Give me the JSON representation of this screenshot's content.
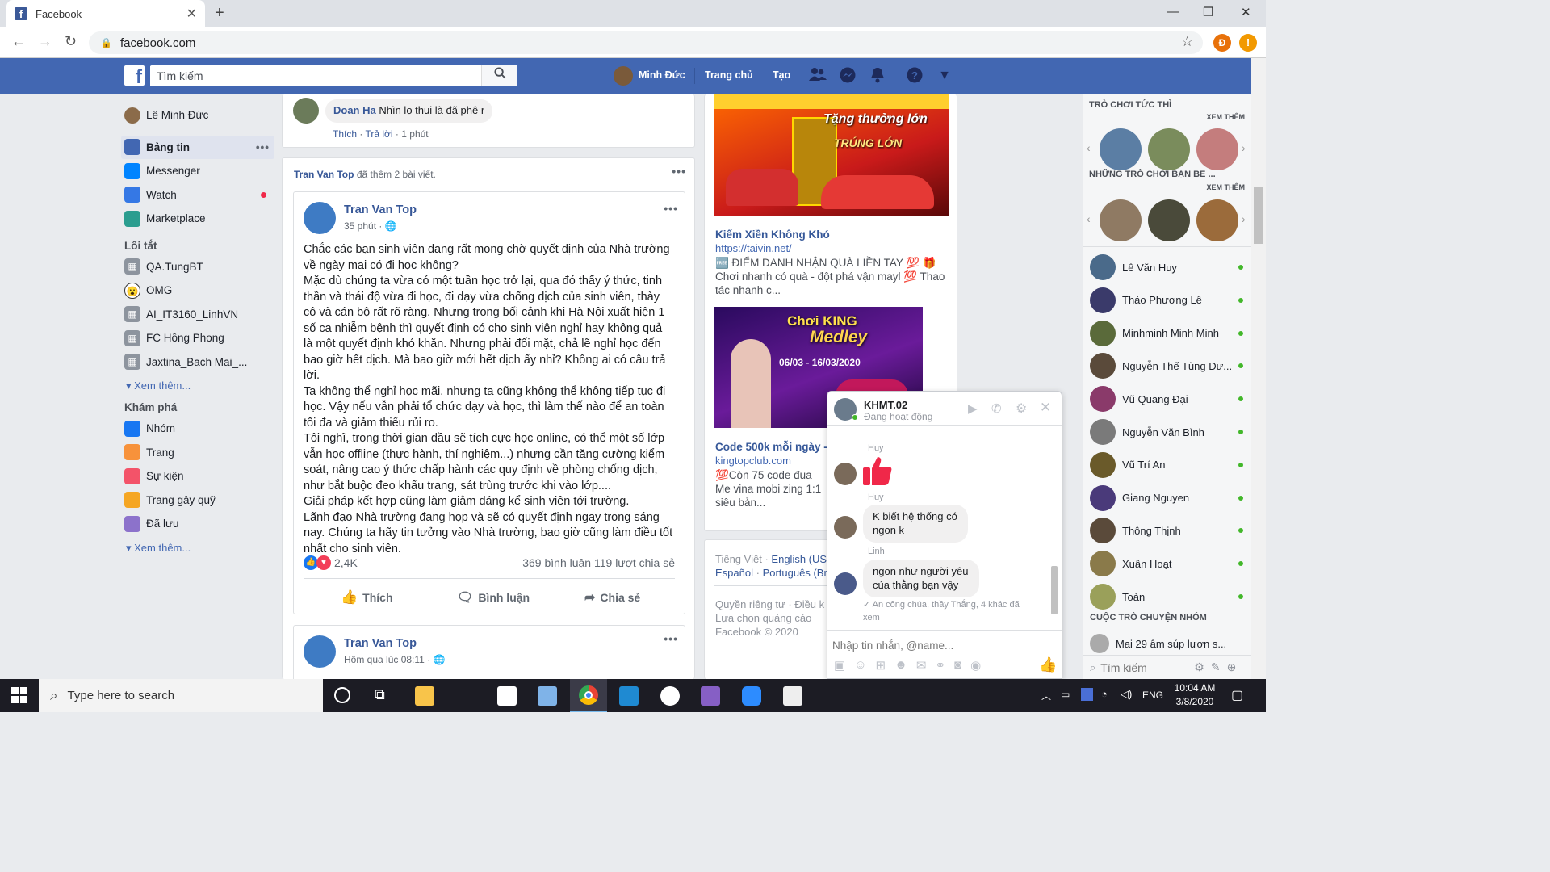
{
  "browser": {
    "tab_title": "Facebook",
    "url": "facebook.com",
    "profile_initial": "Đ",
    "alert_badge": "!"
  },
  "header": {
    "search_placeholder": "Tìm kiếm",
    "user_name": "Minh Đức",
    "home": "Trang chủ",
    "create": "Tạo"
  },
  "sidebar": {
    "profile_name": "Lê Minh Đức",
    "main": [
      {
        "label": "Bảng tin",
        "icon": "news-feed-icon",
        "color": "#4267b2"
      },
      {
        "label": "Messenger",
        "icon": "messenger-icon",
        "color": "#0084ff"
      },
      {
        "label": "Watch",
        "icon": "watch-icon",
        "color": "#3578e5"
      },
      {
        "label": "Marketplace",
        "icon": "marketplace-icon",
        "color": "#2b9d8f"
      }
    ],
    "shortcuts_title": "Lối tắt",
    "shortcuts": [
      {
        "label": "QA.TungBT",
        "icon": "group-icon"
      },
      {
        "label": "OMG",
        "icon": "omg-face-icon"
      },
      {
        "label": "AI_IT3160_LinhVN",
        "icon": "group-icon"
      },
      {
        "label": "FC Hồng Phong",
        "icon": "group-icon"
      },
      {
        "label": "Jaxtina_Bach Mai_...",
        "icon": "group-icon"
      }
    ],
    "see_more": "Xem thêm...",
    "explore_title": "Khám phá",
    "explore": [
      {
        "label": "Nhóm",
        "icon": "groups-icon",
        "color": "#1877f2"
      },
      {
        "label": "Trang",
        "icon": "flag-icon",
        "color": "#f7923b"
      },
      {
        "label": "Sự kiện",
        "icon": "calendar-icon",
        "color": "#f35369"
      },
      {
        "label": "Trang gây quỹ",
        "icon": "fundraiser-icon",
        "color": "#f5a623"
      },
      {
        "label": "Đã lưu",
        "icon": "saved-icon",
        "color": "#8c72cb"
      }
    ],
    "see_more2": "Xem thêm..."
  },
  "feed": {
    "comment": {
      "author": "Doan Ha",
      "text": "Nhìn lọ thui là đã phê r",
      "like": "Thích",
      "reply": "Trả lời",
      "time": "1 phút"
    },
    "group_header": {
      "author": "Tran Van Top",
      "action": "đã thêm 2 bài viết."
    },
    "post1": {
      "author": "Tran Van Top",
      "time": "35 phút",
      "text": "Chắc các bạn sinh viên đang rất mong chờ quyết định của Nhà trường về ngày mai có đi học không?\nMặc dù chúng ta vừa có một tuần học trở lại, qua đó thấy ý thức, tinh thần và thái độ vừa đi học, đi dạy vừa chống dịch của sinh viên, thày cô và cán bộ rất rõ ràng. Nhưng trong bối cảnh khi Hà Nội xuất hiện 1 số ca nhiễm bệnh thì quyết định có cho sinh viên nghỉ hay không quả là một quyết định khó khăn. Nhưng phải đối mặt, chả lẽ nghỉ học đến bao giờ hết dịch. Mà bao giờ mới hết dịch ấy nhỉ? Không ai có câu trả lời.\nTa không thể nghỉ học mãi, nhưng ta cũng không thể không tiếp tục đi học. Vậy nếu vẫn phải tổ chức dạy và học, thì làm thế nào để an toàn tối đa và giảm thiểu rủi ro.\nTôi nghĩ, trong thời gian đầu sẽ tích cực học online, có thể một số lớp vẫn học offline (thực hành, thí nghiệm...) nhưng cần tăng cường kiểm soát, nâng cao ý thức chấp hành các quy định về phòng chống dịch, như bắt buộc đeo khẩu trang, sát trùng trước khi vào lớp....\nGiải pháp kết hợp cũng làm giảm đáng kể sinh viên tới trường.\nLãnh đạo Nhà trường đang họp và sẽ có quyết định ngay trong sáng nay. Chúng ta hãy tin tưởng vào Nhà trường, bao giờ cũng làm điều tốt nhất cho sinh viên.",
      "reactions": "2,4K",
      "comments": "369 bình luận",
      "shares": "119 lượt chia sẻ",
      "like": "Thích",
      "comment_btn": "Bình luận",
      "share_btn": "Chia sẻ"
    },
    "post2": {
      "author": "Tran Van Top",
      "time": "Hôm qua lúc 08:11"
    }
  },
  "ads": {
    "ad1": {
      "title": "Kiếm Xiền Không Khó",
      "url": "https://taivin.net/",
      "desc1": "🆓 ĐIỂM DANH NHẬN QUÀ LIỀN TAY 💯 🎁",
      "desc2": "Chơi nhanh có quà - đột phá vận mayl 💯 Thao tác nhanh c...",
      "banner_line1": "Tặng thưởng lớn",
      "banner_line2": "TRÚNG LỚN"
    },
    "ad2": {
      "title": "Code 500k mỗi ngày -",
      "url": "kingtopclub.com",
      "desc": "💯Còn 75 code đua Me vina mobi zing 1:1 siêu bản...",
      "banner_title": "Chơi KING",
      "banner_sub": "Medley",
      "banner_date": "06/03 - 16/03/2020"
    },
    "footer": {
      "langs_line1": [
        "Tiếng Việt",
        "English (US"
      ],
      "langs_line2": [
        "Español",
        "Português (Br"
      ],
      "links1": "Quyền riêng tư · Điều k",
      "links2": "Lựa chọn quảng cáo",
      "copyright": "Facebook © 2020"
    }
  },
  "right": {
    "instant_games": "TRÒ CHƠI TỨC THÌ",
    "see_more": "XEM THÊM",
    "friends_games": "NHỮNG TRÒ CHƠI BẠN BE ...",
    "see_more2": "XEM THÊM",
    "contacts": [
      "Lê Văn Huy",
      "Thảo Phương Lê",
      "Minhminh Minh Minh",
      "Nguyễn Thế Tùng Dư...",
      "Vũ Quang Đại",
      "Nguyễn Văn Bình",
      "Vũ Trí An",
      "Giang Nguyen",
      "Thông Thịnh",
      "Xuân Hoạt",
      "Toàn"
    ],
    "group_chats": "CUỘC TRÒ CHUYỆN NHÓM",
    "group_preview": "Mai 29 âm súp lươn s...",
    "search_placeholder": "Tìm kiếm"
  },
  "chat": {
    "name": "KHMT.02",
    "status": "Đang hoạt động",
    "sender1": "Huy",
    "sender2": "Huy",
    "msg2": "K biết hệ thống có ngon k",
    "sender3": "Linh",
    "msg3": "ngon như người yêu của thằng bạn vậy",
    "seen": "✓ An công chúa, thầy Thắng, 4 khác đã xem",
    "input_placeholder": "Nhập tin nhắn, @name..."
  },
  "taskbar": {
    "search": "Type here to search",
    "lang": "ENG",
    "time": "10:04 AM",
    "date": "3/8/2020"
  }
}
